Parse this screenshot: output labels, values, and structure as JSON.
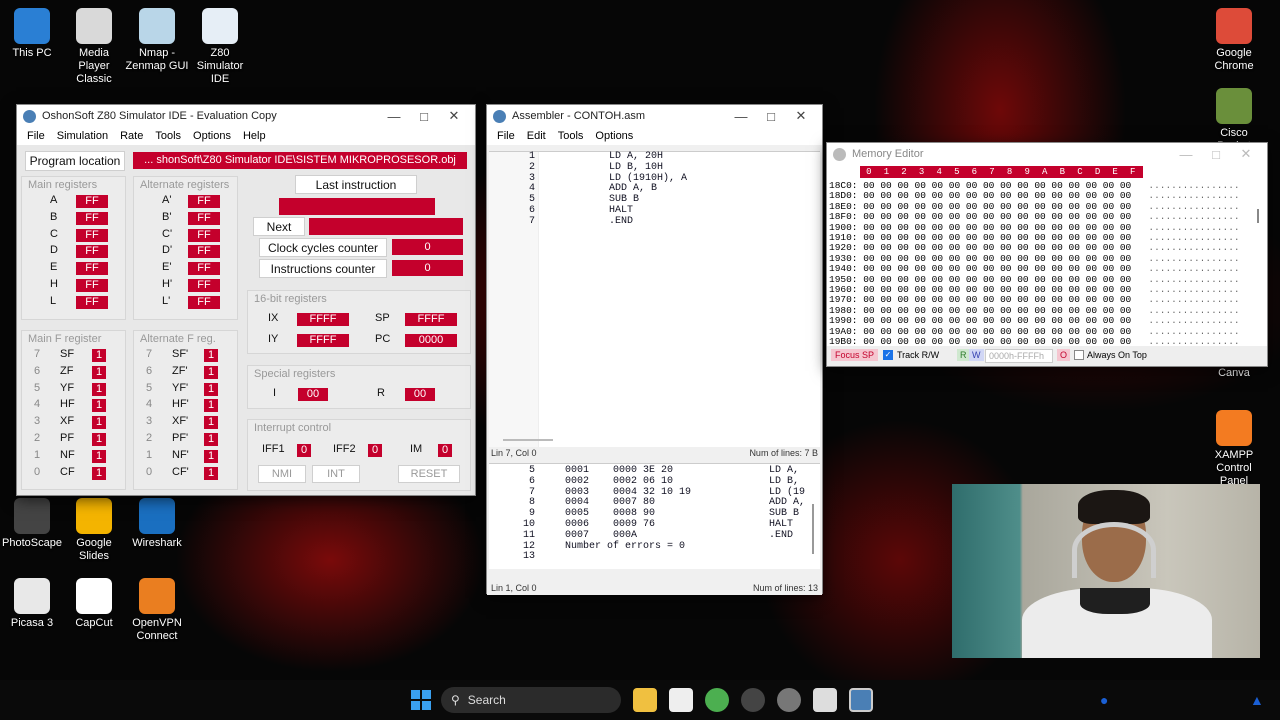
{
  "desktop": {
    "icons": [
      {
        "label": "This PC",
        "name": "this-pc-icon",
        "color": "#2a7fd4"
      },
      {
        "label": "Media Player Classic",
        "name": "media-player-icon",
        "color": "#d9d9d9"
      },
      {
        "label": "Nmap - Zenmap GUI",
        "name": "nmap-icon",
        "color": "#b9d6e8"
      },
      {
        "label": "Z80 Simulator IDE",
        "name": "z80-simulator-icon",
        "color": "#e6eef6"
      },
      {
        "label": "PhotoScape",
        "name": "photoscape-icon",
        "color": "#444"
      },
      {
        "label": "Google Slides",
        "name": "google-slides-icon",
        "color": "#f4b400"
      },
      {
        "label": "Wireshark",
        "name": "wireshark-icon",
        "color": "#1a6fc0"
      },
      {
        "label": "Picasa 3",
        "name": "picasa-icon",
        "color": "#e8e8e8"
      },
      {
        "label": "CapCut",
        "name": "capcut-icon",
        "color": "#fff"
      },
      {
        "label": "OpenVPN Connect",
        "name": "openvpn-icon",
        "color": "#ea7e20"
      },
      {
        "label": "Google Chrome",
        "name": "chrome-icon",
        "color": "#dd4b39"
      },
      {
        "label": "Cisco Packet",
        "name": "cisco-icon",
        "color": "#6a8f3b"
      },
      {
        "label": "Canva",
        "name": "canva-icon",
        "color": "#2fb8c8"
      },
      {
        "label": "XAMPP Control Panel",
        "name": "xampp-icon",
        "color": "#f37b21"
      }
    ]
  },
  "sim": {
    "title": "OshonSoft Z80 Simulator IDE - Evaluation Copy",
    "menu": [
      "File",
      "Simulation",
      "Rate",
      "Tools",
      "Options",
      "Help"
    ],
    "program_location_label": "Program location",
    "program_location_value": "... shonSoft\\Z80 Simulator IDE\\SISTEM MIKROPROSESOR.obj",
    "main_registers_title": "Main registers",
    "main_registers": [
      {
        "n": "A",
        "v": "FF"
      },
      {
        "n": "B",
        "v": "FF"
      },
      {
        "n": "C",
        "v": "FF"
      },
      {
        "n": "D",
        "v": "FF"
      },
      {
        "n": "E",
        "v": "FF"
      },
      {
        "n": "H",
        "v": "FF"
      },
      {
        "n": "L",
        "v": "FF"
      }
    ],
    "alt_registers_title": "Alternate registers",
    "alt_registers": [
      {
        "n": "A'",
        "v": "FF"
      },
      {
        "n": "B'",
        "v": "FF"
      },
      {
        "n": "C'",
        "v": "FF"
      },
      {
        "n": "D'",
        "v": "FF"
      },
      {
        "n": "E'",
        "v": "FF"
      },
      {
        "n": "H'",
        "v": "FF"
      },
      {
        "n": "L'",
        "v": "FF"
      }
    ],
    "last_instruction_label": "Last instruction",
    "next_label": "Next",
    "clock_label": "Clock cycles counter",
    "clock_value": "0",
    "instr_label": "Instructions counter",
    "instr_value": "0",
    "reg16_title": "16-bit registers",
    "ix_label": "IX",
    "ix": "FFFF",
    "sp_label": "SP",
    "sp": "FFFF",
    "iy_label": "IY",
    "iy": "FFFF",
    "pc_label": "PC",
    "pc": "0000",
    "special_title": "Special registers",
    "i_label": "I",
    "i": "00",
    "r_label": "R",
    "r": "00",
    "interrupt_title": "Interrupt control",
    "iff1_label": "IFF1",
    "iff1": "0",
    "iff2_label": "IFF2",
    "iff2": "0",
    "im_label": "IM",
    "im": "0",
    "nmi": "NMI",
    "int": "INT",
    "reset": "RESET",
    "mainf_title": "Main F register",
    "mainf": [
      {
        "b": "7",
        "n": "SF",
        "v": "1"
      },
      {
        "b": "6",
        "n": "ZF",
        "v": "1"
      },
      {
        "b": "5",
        "n": "YF",
        "v": "1"
      },
      {
        "b": "4",
        "n": "HF",
        "v": "1"
      },
      {
        "b": "3",
        "n": "XF",
        "v": "1"
      },
      {
        "b": "2",
        "n": "PF",
        "v": "1"
      },
      {
        "b": "1",
        "n": "NF",
        "v": "1"
      },
      {
        "b": "0",
        "n": "CF",
        "v": "1"
      }
    ],
    "altf_title": "Alternate F reg.",
    "altf": [
      {
        "b": "7",
        "n": "SF'",
        "v": "1"
      },
      {
        "b": "6",
        "n": "ZF'",
        "v": "1"
      },
      {
        "b": "5",
        "n": "YF'",
        "v": "1"
      },
      {
        "b": "4",
        "n": "HF'",
        "v": "1"
      },
      {
        "b": "3",
        "n": "XF'",
        "v": "1"
      },
      {
        "b": "2",
        "n": "PF'",
        "v": "1"
      },
      {
        "b": "1",
        "n": "NF'",
        "v": "1"
      },
      {
        "b": "0",
        "n": "CF'",
        "v": "1"
      }
    ]
  },
  "asm": {
    "title": "Assembler - CONTOH.asm",
    "menu": [
      "File",
      "Edit",
      "Tools",
      "Options"
    ],
    "source": [
      "1",
      "LD A, 20H",
      "2",
      "LD B, 10H",
      "3",
      "LD (1910H), A",
      "4",
      "ADD A, B",
      "5",
      "SUB B",
      "6",
      "HALT",
      "7",
      ".END"
    ],
    "status1_left": "Lin 7, Col 0",
    "status1_right": "Num of lines: 7",
    "status1_flag": "B",
    "listing": [
      "  5     0001    0000 3E 20                LD A,",
      "  6     0002    0002 06 10                LD B,",
      "  7     0003    0004 32 10 19             LD (19",
      "  8     0004    0007 80                   ADD A,",
      "  9     0005    0008 90                   SUB B",
      " 10     0006    0009 76                   HALT",
      " 11     0007    000A                      .END",
      " 12     Number of errors = 0",
      " 13"
    ],
    "status2_left": "Lin 1, Col 0",
    "status2_right": "Num of lines: 13"
  },
  "mem": {
    "title": "Memory Editor",
    "cols": [
      "0",
      "1",
      "2",
      "3",
      "4",
      "5",
      "6",
      "7",
      "8",
      "9",
      "A",
      "B",
      "C",
      "D",
      "E",
      "F"
    ],
    "rows": [
      "18C0:",
      "18D0:",
      "18E0:",
      "18F0:",
      "1900:",
      "1910:",
      "1920:",
      "1930:",
      "1940:",
      "1950:",
      "1960:",
      "1970:",
      "1980:",
      "1990:",
      "19A0:",
      "19B0:"
    ],
    "cell": "00",
    "ascii": "................",
    "focus_sp": "Focus SP",
    "track": "Track R/W",
    "r": "R",
    "w": "W",
    "range": "0000h-FFFFh",
    "o": "O",
    "always_on_top": "Always On Top"
  },
  "taskbar": {
    "search": "Search"
  }
}
